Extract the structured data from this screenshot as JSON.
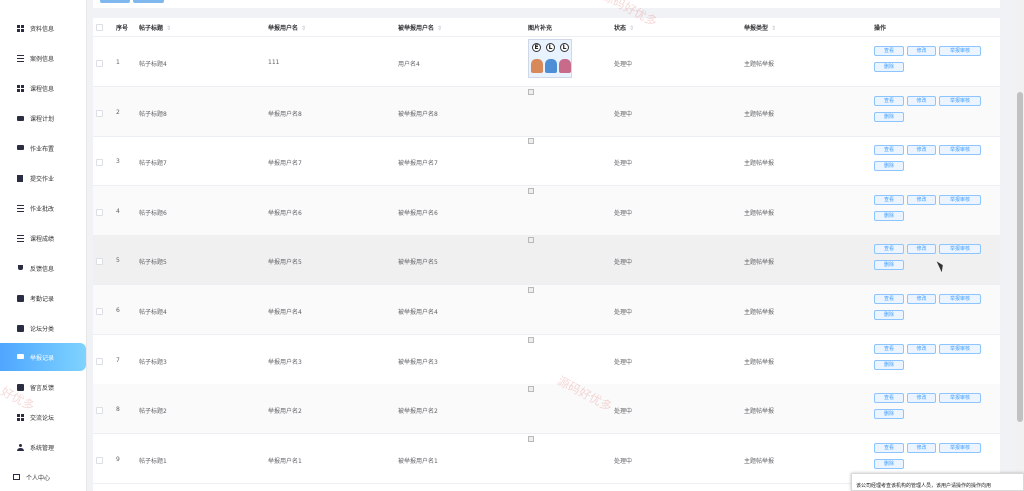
{
  "sidebar": {
    "items": [
      {
        "label": "资料信息",
        "icon": "grid-icon"
      },
      {
        "label": "案例信息",
        "icon": "list-icon"
      },
      {
        "label": "课程信息",
        "icon": "grid-icon"
      },
      {
        "label": "课程计划",
        "icon": "briefcase-icon"
      },
      {
        "label": "作业布置",
        "icon": "chat-icon"
      },
      {
        "label": "提交作业",
        "icon": "book-icon"
      },
      {
        "label": "作业批改",
        "icon": "sliders-icon"
      },
      {
        "label": "课程成绩",
        "icon": "list-icon"
      },
      {
        "label": "反馈信息",
        "icon": "trophy-icon"
      },
      {
        "label": "考勤记录",
        "icon": "check-square-icon"
      },
      {
        "label": "论坛分类",
        "icon": "calendar-icon"
      },
      {
        "label": "举报记录",
        "icon": "message-icon"
      },
      {
        "label": "留言反馈",
        "icon": "clipboard-icon"
      },
      {
        "label": "交流论坛",
        "icon": "grid-icon"
      },
      {
        "label": "系统管理",
        "icon": "person-icon"
      },
      {
        "label": "个人中心",
        "icon": "monitor-icon"
      }
    ],
    "active_index": 11
  },
  "table": {
    "headers": {
      "index": "序号",
      "title": "帖子标题",
      "reporter": "举报用户名",
      "reported": "被举报用户名",
      "image": "图片补充",
      "status": "状态",
      "type": "举报类型",
      "actions": "操作"
    },
    "rows": [
      {
        "index": "1",
        "title": "帖子标题4",
        "reporter": "111",
        "reported": "用户名4",
        "status": "处理中",
        "type": "主题帖举报",
        "has_image": true
      },
      {
        "index": "2",
        "title": "帖子标题8",
        "reporter": "举报用户名8",
        "reported": "被举报用户名8",
        "status": "处理中",
        "type": "主题帖举报",
        "has_image": false
      },
      {
        "index": "3",
        "title": "帖子标题7",
        "reporter": "举报用户名7",
        "reported": "被举报用户名7",
        "status": "处理中",
        "type": "主题帖举报",
        "has_image": false
      },
      {
        "index": "4",
        "title": "帖子标题6",
        "reporter": "举报用户名6",
        "reported": "被举报用户名6",
        "status": "处理中",
        "type": "主题帖举报",
        "has_image": false
      },
      {
        "index": "5",
        "title": "帖子标题5",
        "reporter": "举报用户名5",
        "reported": "被举报用户名5",
        "status": "处理中",
        "type": "主题帖举报",
        "has_image": false
      },
      {
        "index": "6",
        "title": "帖子标题4",
        "reporter": "举报用户名4",
        "reported": "被举报用户名4",
        "status": "处理中",
        "type": "主题帖举报",
        "has_image": false
      },
      {
        "index": "7",
        "title": "帖子标题3",
        "reporter": "举报用户名3",
        "reported": "被举报用户名3",
        "status": "处理中",
        "type": "主题帖举报",
        "has_image": false
      },
      {
        "index": "8",
        "title": "帖子标题2",
        "reporter": "举报用户名2",
        "reported": "被举报用户名2",
        "status": "处理中",
        "type": "主题帖举报",
        "has_image": false
      },
      {
        "index": "9",
        "title": "帖子标题1",
        "reporter": "举报用户名1",
        "reported": "被举报用户名1",
        "status": "处理中",
        "type": "主题帖举报",
        "has_image": false
      }
    ],
    "row_buttons": {
      "view": "查看",
      "edit": "修改",
      "review": "举报审核",
      "delete": "删除"
    }
  },
  "thumbnail_letters": [
    "E",
    "L",
    "L"
  ],
  "watermark": [
    "源码好优多",
    "源码好优多",
    "好优多"
  ],
  "tooltip_text": "该公司经理考查该机构的管理人员，该用户请操作的操作向用"
}
